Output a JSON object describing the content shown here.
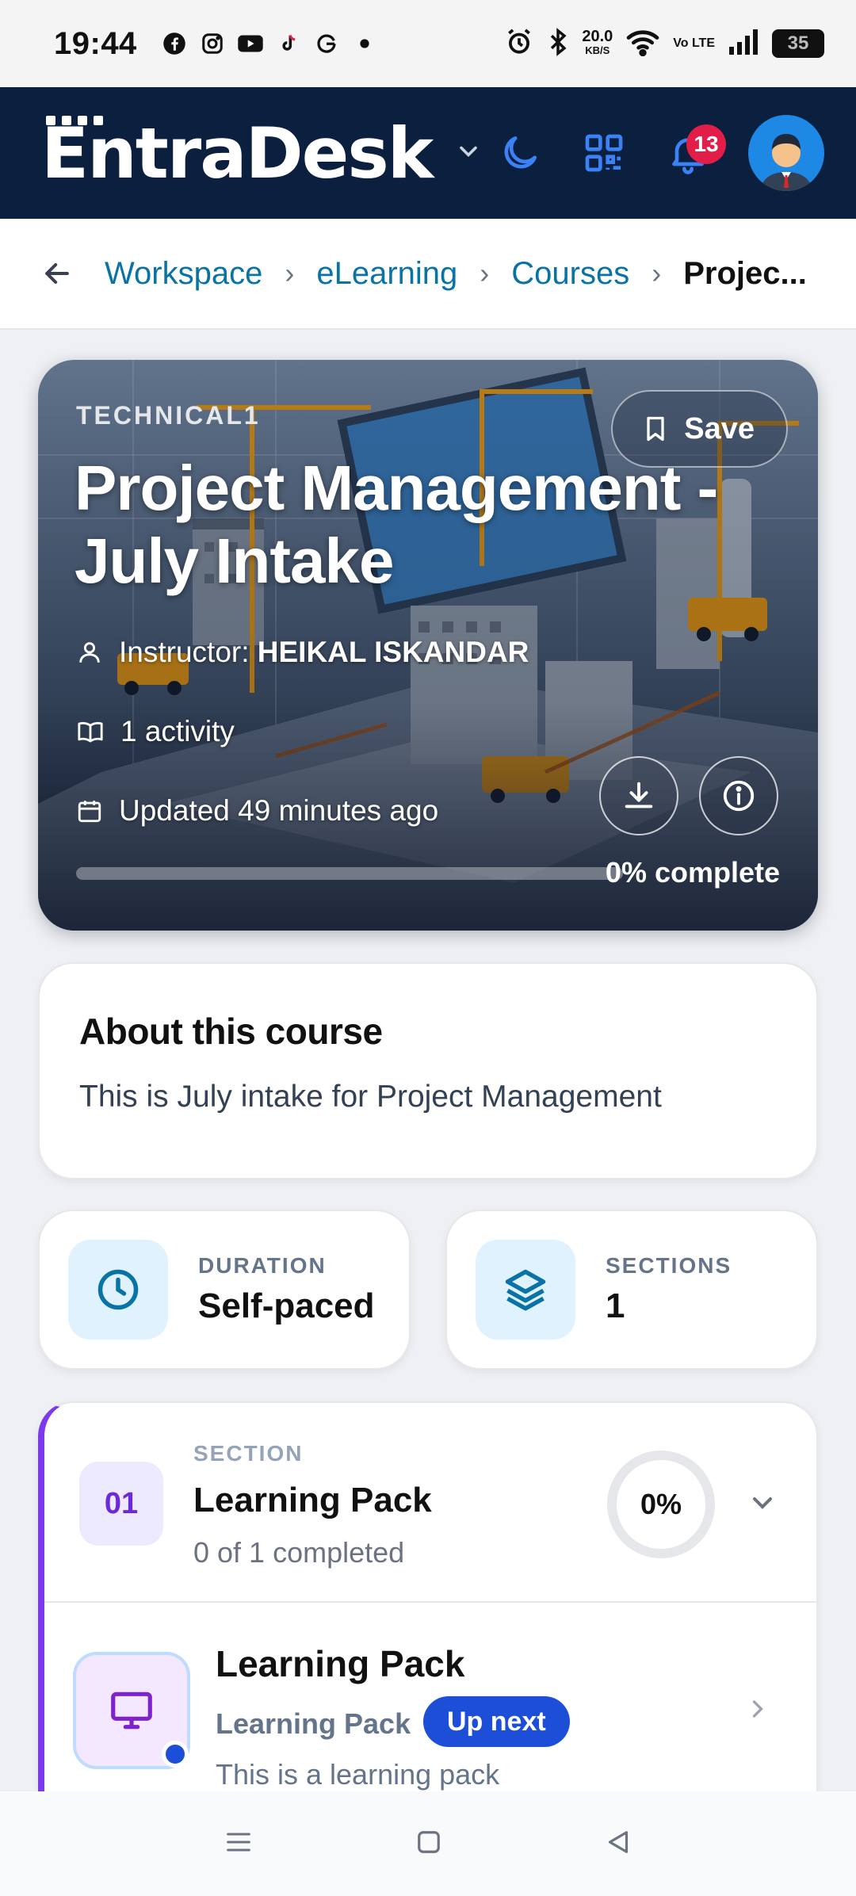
{
  "status_bar": {
    "time": "19:44",
    "network_speed": "20.0",
    "network_speed_unit": "KB/S",
    "volte": "Vo LTE",
    "battery": "35",
    "apps": [
      "facebook-icon",
      "instagram-icon",
      "youtube-icon",
      "tiktok-icon",
      "google-icon",
      "dot-icon"
    ]
  },
  "header": {
    "logo": "EntraDesk",
    "notification_count": "13",
    "accent_color": "#3b82f6",
    "background_color": "#0b1f3f"
  },
  "breadcrumb": {
    "items": [
      "Workspace",
      "eLearning",
      "Courses"
    ],
    "current": "Projec..."
  },
  "course": {
    "category": "TECHNICAL1",
    "save_label": "Save",
    "title": "Project Management - July Intake",
    "instructor_label": "Instructor:",
    "instructor_name": "HEIKAL ISKANDAR",
    "activities": "1 activity",
    "updated": "Updated 49 minutes ago",
    "progress_percent": 0,
    "progress_label": "0% complete"
  },
  "about": {
    "heading": "About this course",
    "description": "This is July intake for Project Management"
  },
  "stats": {
    "duration_label": "DURATION",
    "duration_value": "Self-paced",
    "sections_label": "SECTIONS",
    "sections_value": "1"
  },
  "section": {
    "number": "01",
    "eyebrow": "SECTION",
    "title": "Learning Pack",
    "completed": "0 of 1 completed",
    "percent": "0%",
    "accent_color": "#7c3aed",
    "items": [
      {
        "title": "Learning Pack",
        "type": "Learning Pack",
        "badge": "Up next",
        "description": "This is a learning pack"
      }
    ]
  }
}
